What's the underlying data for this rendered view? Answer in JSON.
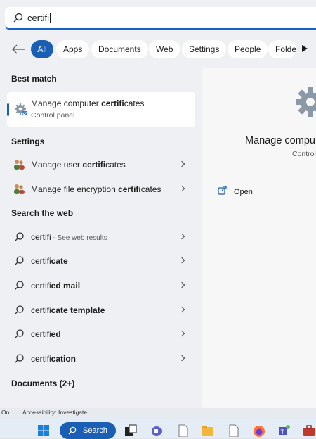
{
  "search": {
    "query": "certifi"
  },
  "filters": {
    "chips": [
      "All",
      "Apps",
      "Documents",
      "Web",
      "Settings",
      "People",
      "Folde"
    ]
  },
  "best_match": {
    "heading": "Best match",
    "title_pre": "Manage computer ",
    "title_bold": "certifi",
    "title_post": "cates",
    "subtitle": "Control panel"
  },
  "settings": {
    "heading": "Settings",
    "items": [
      {
        "pre": "Manage user ",
        "bold": "certifi",
        "post": "cates"
      },
      {
        "pre": "Manage file encryption ",
        "bold": "certifi",
        "post": "cates"
      }
    ]
  },
  "web": {
    "heading": "Search the web",
    "first": {
      "text": "certifi",
      "suffix": " - See web results"
    },
    "items": [
      {
        "pre": "certifi",
        "bold": "cate"
      },
      {
        "pre": "certifi",
        "bold": "ed mail"
      },
      {
        "pre": "certifi",
        "bold": "cate template"
      },
      {
        "pre": "certifi",
        "bold": "ed"
      },
      {
        "pre": "certifi",
        "bold": "cation"
      }
    ]
  },
  "documents": {
    "heading": "Documents (2+)"
  },
  "preview": {
    "title": "Manage compu",
    "subtitle": "Control",
    "open_label": "Open"
  },
  "statusbar": {
    "left": "On",
    "accessibility": "Accessibility: Investigate"
  },
  "taskbar": {
    "search_label": "Search"
  },
  "colors": {
    "accent": "#1a5fb4",
    "panel": "#eef0f3"
  }
}
